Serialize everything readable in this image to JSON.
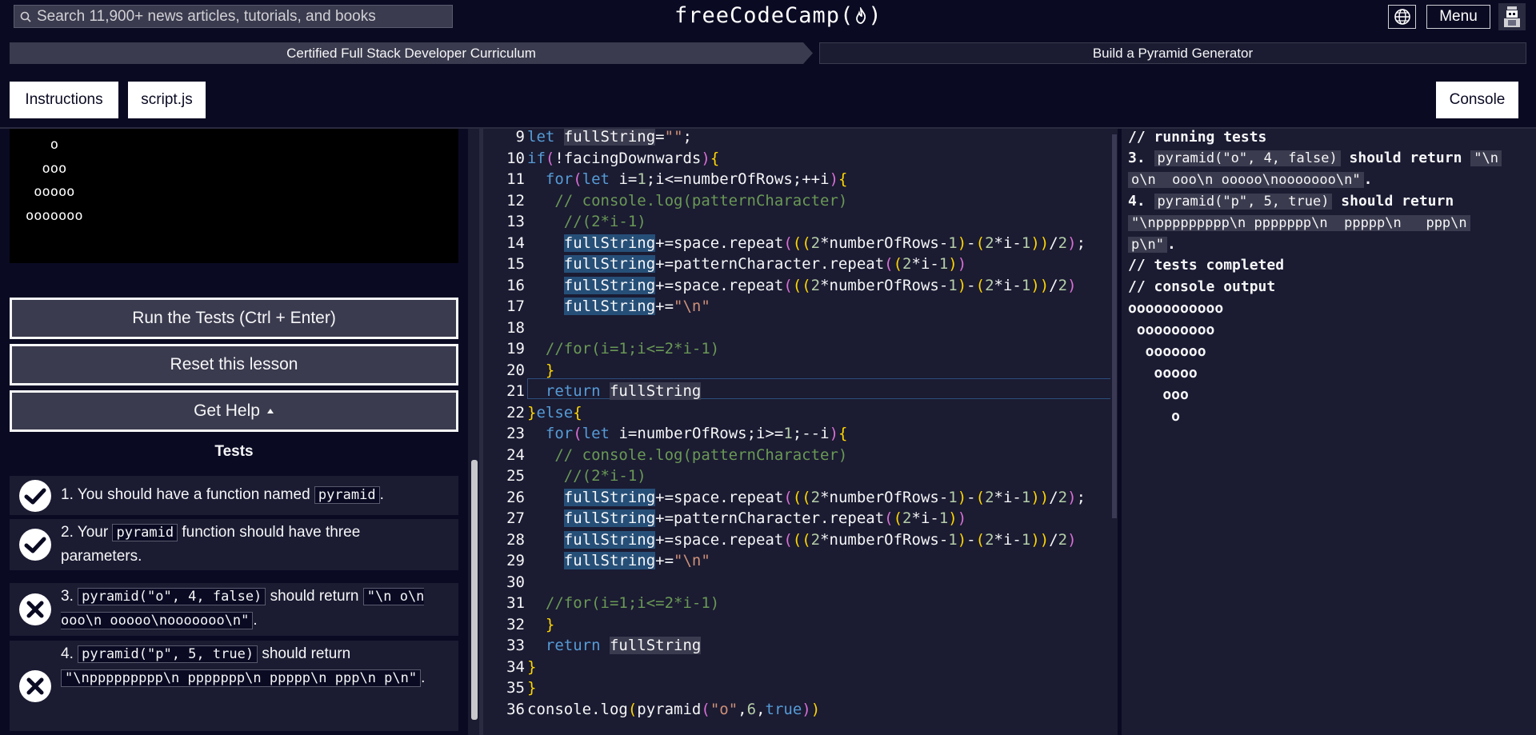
{
  "header": {
    "search_placeholder": "Search 11,900+ news articles, tutorials, and books",
    "logo_text": "freeCodeCamp(",
    "logo_text_end": ")",
    "menu_label": "Menu"
  },
  "breadcrumb": {
    "curriculum": "Certified Full Stack Developer Curriculum",
    "lesson": "Build a Pyramid Generator"
  },
  "tabs": {
    "instructions": "Instructions",
    "script": "script.js",
    "console": "Console"
  },
  "preview": {
    "lines": [
      "   o",
      "  ooo",
      " ooooo",
      "ooooooo"
    ]
  },
  "actions": {
    "run": "Run the Tests (Ctrl + Enter)",
    "reset": "Reset this lesson",
    "help": "Get Help"
  },
  "tests": {
    "heading": "Tests",
    "items": [
      {
        "prefix": "1. You should have a function named ",
        "code": "pyramid",
        "suffix": ".",
        "status": "pass"
      },
      {
        "prefix": "2. Your ",
        "code": "pyramid",
        "suffix": " function should have three parameters.",
        "status": "pass"
      },
      {
        "prefix": "3. ",
        "code": "pyramid(\"o\", 4, false)",
        "mid": " should return ",
        "code2": "\"\\n o\\n  ooo\\n ooooo\\nooooooo\\n\"",
        "suffix": ".",
        "status": "fail"
      },
      {
        "prefix": "4. ",
        "code": "pyramid(\"p\", 5, true)",
        "mid": " should return ",
        "code2": "\"\\nppppppppp\\n ppppppp\\n  ppppp\\n   ppp\\n p\\n\"",
        "suffix": ".",
        "status": "fail"
      }
    ]
  },
  "editor": {
    "line_numbers": [
      9,
      10,
      11,
      12,
      13,
      14,
      15,
      16,
      17,
      18,
      19,
      20,
      21,
      22,
      23,
      24,
      25,
      26,
      27,
      28,
      29,
      30,
      31,
      32,
      33,
      34,
      35,
      36
    ]
  },
  "console": {
    "running": "// running tests",
    "t3_num": "3. ",
    "t3_code": "pyramid(\"o\", 4, false)",
    "t3_mid": " should return ",
    "t3_ret1": "\"\\n",
    "t3_ret2": "o\\n  ooo\\n ooooo\\nooooooo\\n\"",
    "t4_num": "4. ",
    "t4_code": "pyramid(\"p\", 5, true)",
    "t4_mid": " should return",
    "t4_ret1": "\"\\nppppppppp\\n ppppppp\\n  ppppp\\n   ppp\\n",
    "t4_ret2": "p\\n\"",
    "completed": "// tests completed",
    "output_label": "// console output",
    "output": [
      "ooooooooooo",
      " ooooooooo",
      "  ooooooo",
      "   ooooo",
      "    ooo",
      "     o"
    ]
  },
  "colors": {
    "background": "#0a0a23",
    "panel": "#1b1b32",
    "button": "#3b3b4f",
    "keyword": "#569cd6",
    "string": "#ce9178",
    "comment": "#6a9955"
  }
}
